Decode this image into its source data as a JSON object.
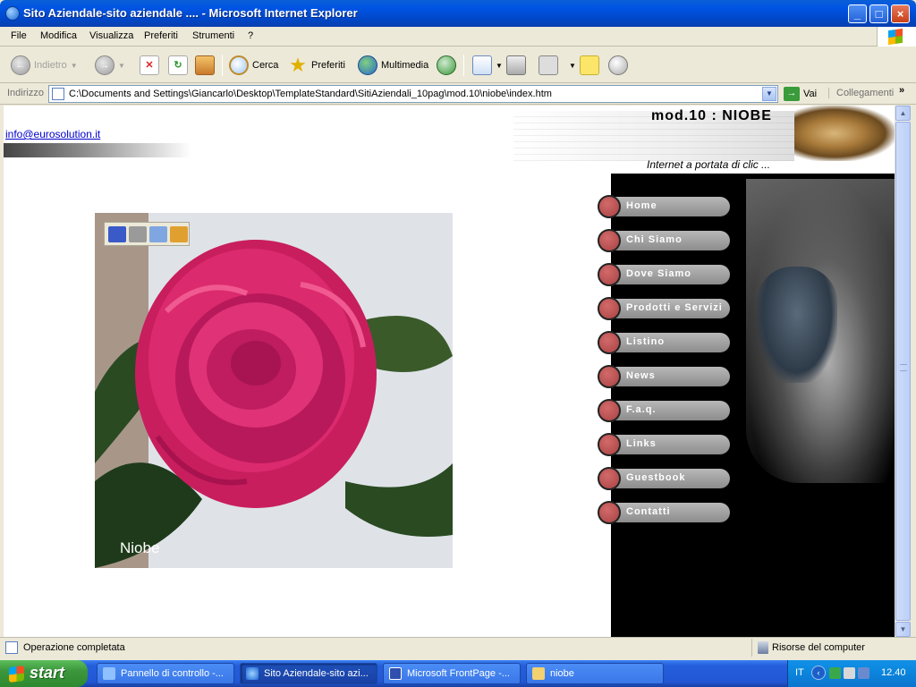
{
  "window": {
    "title": "Sito Aziendale-sito aziendale .... - Microsoft Internet Explorer",
    "minimize": "_",
    "maximize": "□",
    "close": "×"
  },
  "menubar": {
    "items": [
      "File",
      "Modifica",
      "Visualizza",
      "Preferiti",
      "Strumenti",
      "?"
    ]
  },
  "toolbar": {
    "back_label": "Indietro",
    "search_label": "Cerca",
    "favorites_label": "Preferiti",
    "media_label": "Multimedia"
  },
  "addressbar": {
    "label": "Indirizzo",
    "value": "C:\\Documents and Settings\\Giancarlo\\Desktop\\TemplateStandard\\SitiAziendali_10pag\\mod.10\\niobe\\index.htm",
    "go_label": "Vai",
    "links_label": "Collegamenti"
  },
  "page": {
    "email": "info@eurosolution.it",
    "site_title": "mod.10  :  NIOBE",
    "tagline": "Internet a portata di clic ...",
    "image_caption": "Niobe",
    "nav": [
      "Home",
      "Chi Siamo",
      "Dove Siamo",
      "Prodotti e Servizi",
      "Listino",
      "News",
      "F.a.q.",
      "Links",
      "Guestbook",
      "Contatti"
    ]
  },
  "statusbar": {
    "text": "Operazione completata",
    "zone": "Risorse del computer"
  },
  "taskbar": {
    "start_label": "start",
    "tasks": [
      "Pannello di controllo -...",
      "Sito Aziendale-sito azi...",
      "Microsoft FrontPage -...",
      "niobe"
    ],
    "language": "IT",
    "clock": "12.40"
  },
  "colors": {
    "xp_blue": "#0054e3",
    "nav_pill": "#9c9c9c",
    "nav_dot": "#b04848",
    "flower": "#d8266a",
    "panel": "#000000"
  }
}
